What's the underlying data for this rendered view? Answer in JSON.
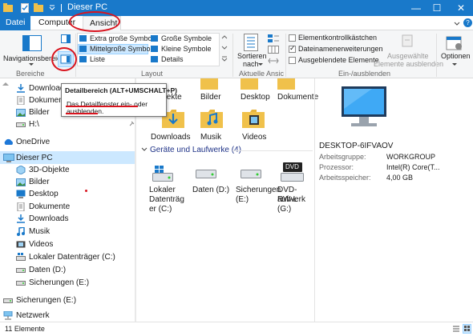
{
  "window": {
    "title": "Dieser PC",
    "accent": "#1979ca"
  },
  "titlebar": {
    "qat_icons": [
      "file-manager-icon",
      "properties-icon",
      "new-folder-icon",
      "dropdown-icon"
    ],
    "min_label": "—",
    "max_label": "☐",
    "close_label": "✕"
  },
  "tabs": {
    "datei": "Datei",
    "computer": "Computer",
    "ansicht": "Ansicht"
  },
  "ribbon": {
    "navpane": "Navigationsbereich",
    "bereiche": "Bereiche",
    "layout": {
      "extra_large": "Extra große Symbole",
      "large": "Große Symbole",
      "medium": "Mittelgroße Symbole",
      "small": "Kleine Symbole",
      "list": "Liste",
      "details": "Details",
      "group": "Layout"
    },
    "sort": {
      "label1": "Sortieren",
      "label2": "nach",
      "group": "Aktuelle Ansic"
    },
    "show_hide": {
      "item_checkboxes": "Elementkontrollkästchen",
      "file_extensions": "Dateinamenerweiterungen",
      "hidden_items": "Ausgeblendete Elemente",
      "hide_selected1": "Ausgewählte",
      "hide_selected2": "Elemente ausblenden",
      "group": "Ein-/ausblenden",
      "item_checkboxes_checked": false,
      "file_extensions_checked": true,
      "hidden_items_checked": false
    },
    "options": "Optionen"
  },
  "tooltip": {
    "title": "Detailbereich (ALT+UMSCHALT+P)",
    "line1": "Das Detailfenster ein- oder",
    "line2": "ausblenden."
  },
  "nav": {
    "quick": [
      "Download",
      "Dokument",
      "Bilder",
      "H:\\"
    ],
    "onedrive": "OneDrive",
    "thispc": "Dieser PC",
    "thispc_children": [
      "3D-Objekte",
      "Bilder",
      "Desktop",
      "Dokumente",
      "Downloads",
      "Musik",
      "Videos",
      "Lokaler Datenträger (C:)",
      "Daten (D:)",
      "Sicherungen (E:)"
    ],
    "sicherungen": "Sicherungen (E:)",
    "network": "Netzwerk"
  },
  "content": {
    "folders_row1": [
      "bjekte",
      "Bilder",
      "Desktop",
      "Dokumente"
    ],
    "folders_row2": [
      "Downloads",
      "Musik",
      "Videos"
    ],
    "devices_header": "Geräte und Laufwerke (4)",
    "drives": [
      {
        "l1": "Lokaler",
        "l2": "Datenträg",
        "l3": "er (C:)"
      },
      {
        "l1": "Daten (D:)",
        "l2": "",
        "l3": ""
      },
      {
        "l1": "Sicherungen",
        "l2": "(E:)",
        "l3": ""
      },
      {
        "l1": "DVD-RW-L",
        "l2": "aufwerk",
        "l3": "(G:)"
      }
    ],
    "dvd_badge": "DVD"
  },
  "details": {
    "name": "DESKTOP-6IFVAOV",
    "rows": [
      {
        "k": "Arbeitsgruppe:",
        "v": "WORKGROUP"
      },
      {
        "k": "Prozessor:",
        "v": "Intel(R) Core(T..."
      },
      {
        "k": "Arbeitsspeicher:",
        "v": "4,00 GB"
      }
    ]
  },
  "status": {
    "count": "11 Elemente"
  }
}
